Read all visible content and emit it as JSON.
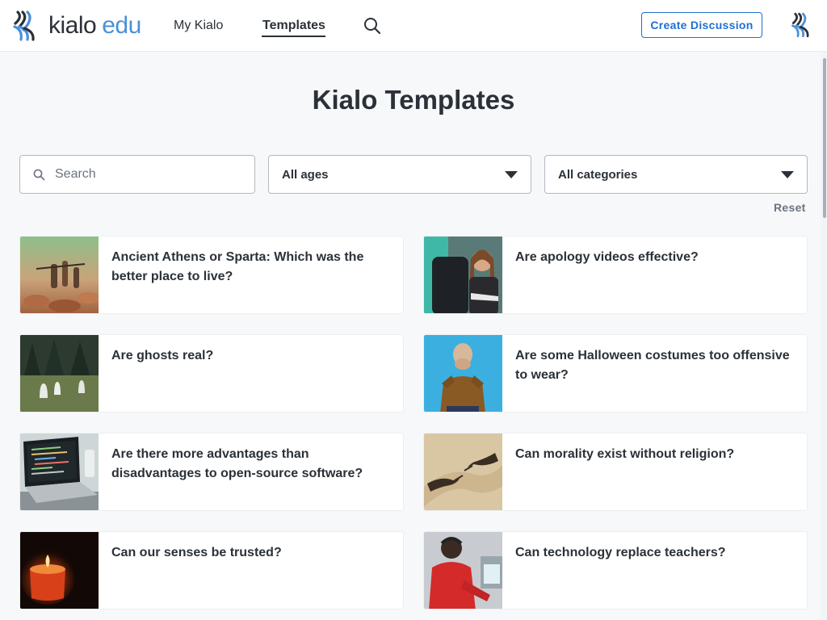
{
  "header": {
    "logo": {
      "word1": "kialo",
      "word2": "edu"
    },
    "nav": {
      "my_kialo": "My Kialo",
      "templates": "Templates"
    },
    "create_button": "Create Discussion",
    "search_icon": "search-icon",
    "avatar_icon": "kialo-logo-icon"
  },
  "page": {
    "title": "Kialo Templates"
  },
  "filters": {
    "search_placeholder": "Search",
    "ages_selected": "All ages",
    "categories_selected": "All categories",
    "reset": "Reset"
  },
  "cards": [
    {
      "title": "Ancient Athens or Sparta: Which was the better place to live?",
      "image": "toy-soldiers-photo"
    },
    {
      "title": "Are apology videos effective?",
      "image": "woman-in-chair-photo"
    },
    {
      "title": "Are ghosts real?",
      "image": "forest-ghosts-photo"
    },
    {
      "title": "Are some Halloween costumes too offensive to wear?",
      "image": "surprised-woman-photo"
    },
    {
      "title": "Are there more advantages than disadvantages to open-source software?",
      "image": "laptop-code-photo"
    },
    {
      "title": "Can morality exist without religion?",
      "image": "reaching-hands-art"
    },
    {
      "title": "Can our senses be trusted?",
      "image": "candle-photo"
    },
    {
      "title": "Can technology replace teachers?",
      "image": "student-computer-photo"
    }
  ],
  "colors": {
    "accent": "#1f6fd1",
    "logo_blue": "#4a90d9",
    "text": "#2b3138",
    "background": "#f7f8fa"
  }
}
